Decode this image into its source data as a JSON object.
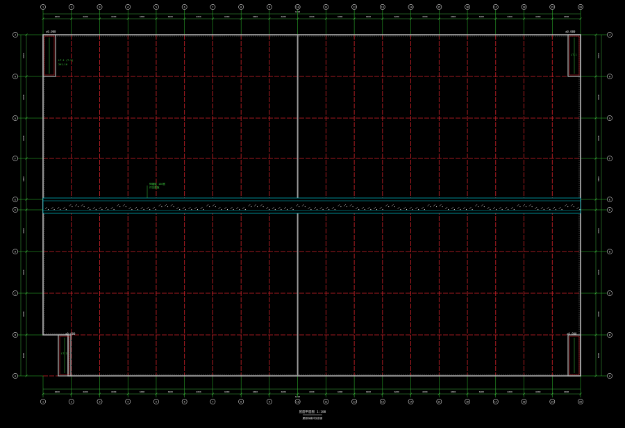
{
  "drawing": {
    "colors": {
      "background": "#000000",
      "grid_line": "#d8232a",
      "axis_line": "#32c832",
      "bubble": "#d9d9d9",
      "dimension": "#3fae3f",
      "outline": "#b9b9b9",
      "wall": "#7a7a7a",
      "expansion_joint": "#00c8d4",
      "annotation": "#3fd23f",
      "text": "#e6e6e6"
    },
    "column_axes": [
      "1",
      "2",
      "3",
      "4",
      "5",
      "6",
      "7",
      "8",
      "9",
      "10",
      "11",
      "12",
      "13",
      "14",
      "15",
      "16",
      "17",
      "18",
      "19",
      "20"
    ],
    "column_axis_center": "10",
    "row_axes_upper": [
      "E",
      "F",
      "G",
      "H",
      "J"
    ],
    "row_axes_lower": [
      "A",
      "B",
      "C",
      "D",
      "E"
    ],
    "column_spacing": "6000",
    "top_center_dim": "9/10",
    "bottom_center_dim": "8/10",
    "row_spacing_upper": "6000",
    "row_spacing_lower": "6000",
    "corner_tags": {
      "top_left": "±0.000",
      "top_right": "±0.000",
      "bottom_left": "±0.000",
      "bottom_right": "±0.000"
    },
    "annotations": {
      "stair_left_note_1": "LT-1 (T-2)",
      "stair_left_note_2": "2H1-16",
      "stair_right_note": "LT-1",
      "expansion_joint_note_1": "伸缩缝 150宽",
      "expansion_joint_note_2": "详见建施",
      "bottom_stair_note": "LT-2"
    },
    "title": {
      "main": "屋面平面图 1:100",
      "sub": "屋面标高详见剖面"
    }
  }
}
